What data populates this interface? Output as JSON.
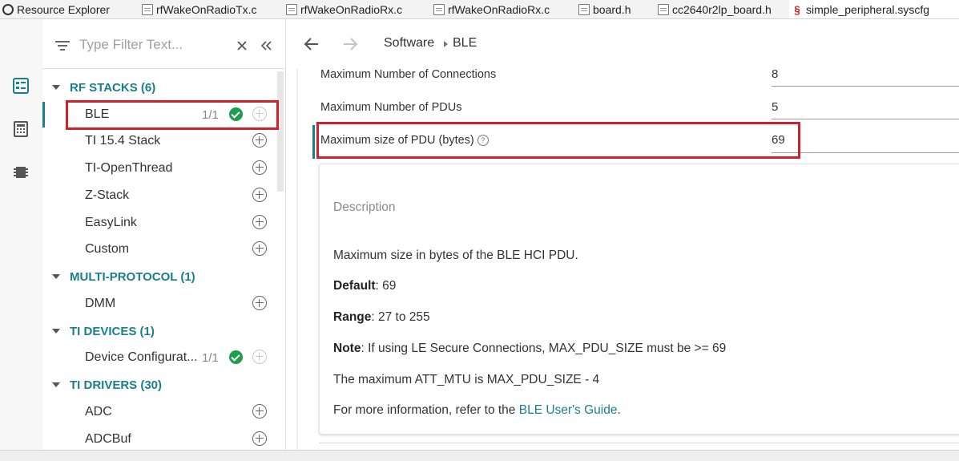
{
  "tabs": [
    {
      "label": "Resource Explorer",
      "icon": "resource-explorer-icon"
    },
    {
      "label": "rfWakeOnRadioTx.c",
      "icon": "c-file-icon"
    },
    {
      "label": "rfWakeOnRadioRx.c",
      "icon": "c-file-icon"
    },
    {
      "label": "rfWakeOnRadioRx.c",
      "icon": "c-file-icon"
    },
    {
      "label": "board.h",
      "icon": "h-file-icon"
    },
    {
      "label": "cc2640r2lp_board.h",
      "icon": "h-file-icon"
    },
    {
      "label": "simple_peripheral.syscfg",
      "icon": "syscfg-file-icon",
      "active": true
    }
  ],
  "filter": {
    "placeholder": "Type Filter Text...",
    "value": ""
  },
  "tree": {
    "rf_stacks": {
      "label": "RF STACKS (6)",
      "items": [
        {
          "label": "BLE",
          "count": "1/1",
          "selected": true
        },
        {
          "label": "TI 15.4 Stack"
        },
        {
          "label": "TI-OpenThread"
        },
        {
          "label": "Z-Stack"
        },
        {
          "label": "EasyLink"
        },
        {
          "label": "Custom"
        }
      ]
    },
    "multi_protocol": {
      "label": "MULTI-PROTOCOL (1)",
      "items": [
        {
          "label": "DMM"
        }
      ]
    },
    "ti_devices": {
      "label": "TI DEVICES (1)",
      "items": [
        {
          "label": "Device Configurat...",
          "count": "1/1"
        }
      ]
    },
    "ti_drivers": {
      "label": "TI DRIVERS (30)",
      "items": [
        {
          "label": "ADC"
        },
        {
          "label": "ADCBuf"
        }
      ]
    }
  },
  "breadcrumb": {
    "root": "Software",
    "current": "BLE"
  },
  "properties": [
    {
      "label": "Maximum Number of Connections",
      "value": "8"
    },
    {
      "label": "Maximum Number of PDUs",
      "value": "5"
    },
    {
      "label": "Maximum size of PDU (bytes)",
      "value": "69",
      "help": "?"
    }
  ],
  "description": {
    "title": "Description",
    "summary": "Maximum size in bytes of the BLE HCI PDU.",
    "default_label": "Default",
    "default_value": ": 69",
    "range_label": "Range",
    "range_value": ": 27 to 255",
    "note_label": "Note",
    "note_value": ": If using LE Secure Connections, MAX_PDU_SIZE must be >= 69",
    "att_mtu": "The maximum ATT_MTU is MAX_PDU_SIZE - 4",
    "more_info_prefix": "For more information, refer to the ",
    "more_info_link": "BLE User's Guide",
    "more_info_suffix": "."
  },
  "colors": {
    "accent": "#1a7f8a",
    "highlight": "#d0202a",
    "check": "#1e9e4c"
  }
}
